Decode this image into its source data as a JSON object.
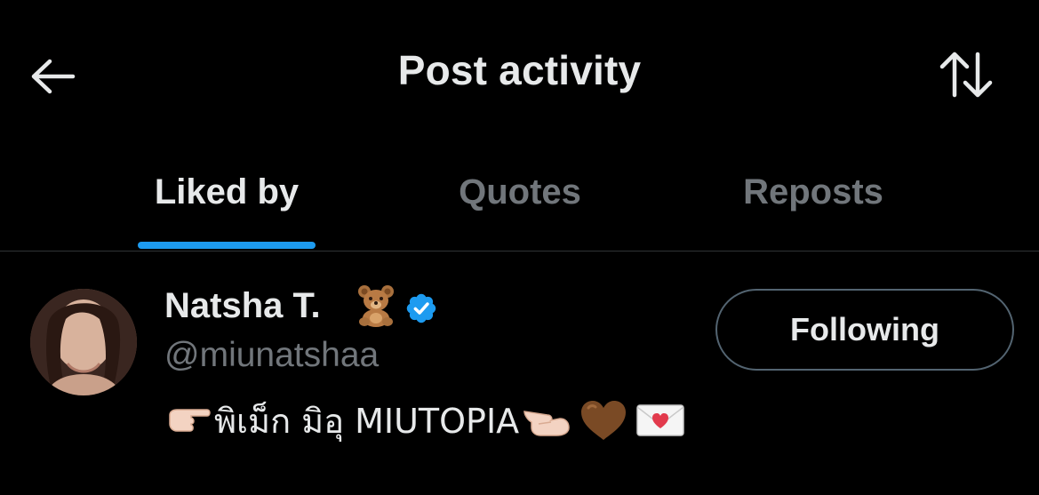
{
  "header": {
    "title": "Post activity",
    "back_icon": "arrow-left-icon",
    "sort_icon": "sort-arrows-icon"
  },
  "tabs": [
    {
      "label": "Liked by",
      "active": true
    },
    {
      "label": "Quotes",
      "active": false
    },
    {
      "label": "Reposts",
      "active": false
    }
  ],
  "user": {
    "display_name": "Natsha T.",
    "name_emoji": "teddy-bear-icon",
    "verified": true,
    "handle": "@miunatshaa",
    "bio_text": "พิเม็ก มิอุ MIUTOPIA",
    "bio_emojis": [
      "backhand-index-pointing-right-icon",
      "pinching-hand-icon",
      "brown-heart-icon",
      "love-letter-icon"
    ],
    "follow_button_label": "Following"
  },
  "colors": {
    "background": "#000000",
    "text_primary": "#e7e9ea",
    "text_secondary": "#71767b",
    "accent": "#1d9bf0",
    "divider": "#2f3336"
  }
}
